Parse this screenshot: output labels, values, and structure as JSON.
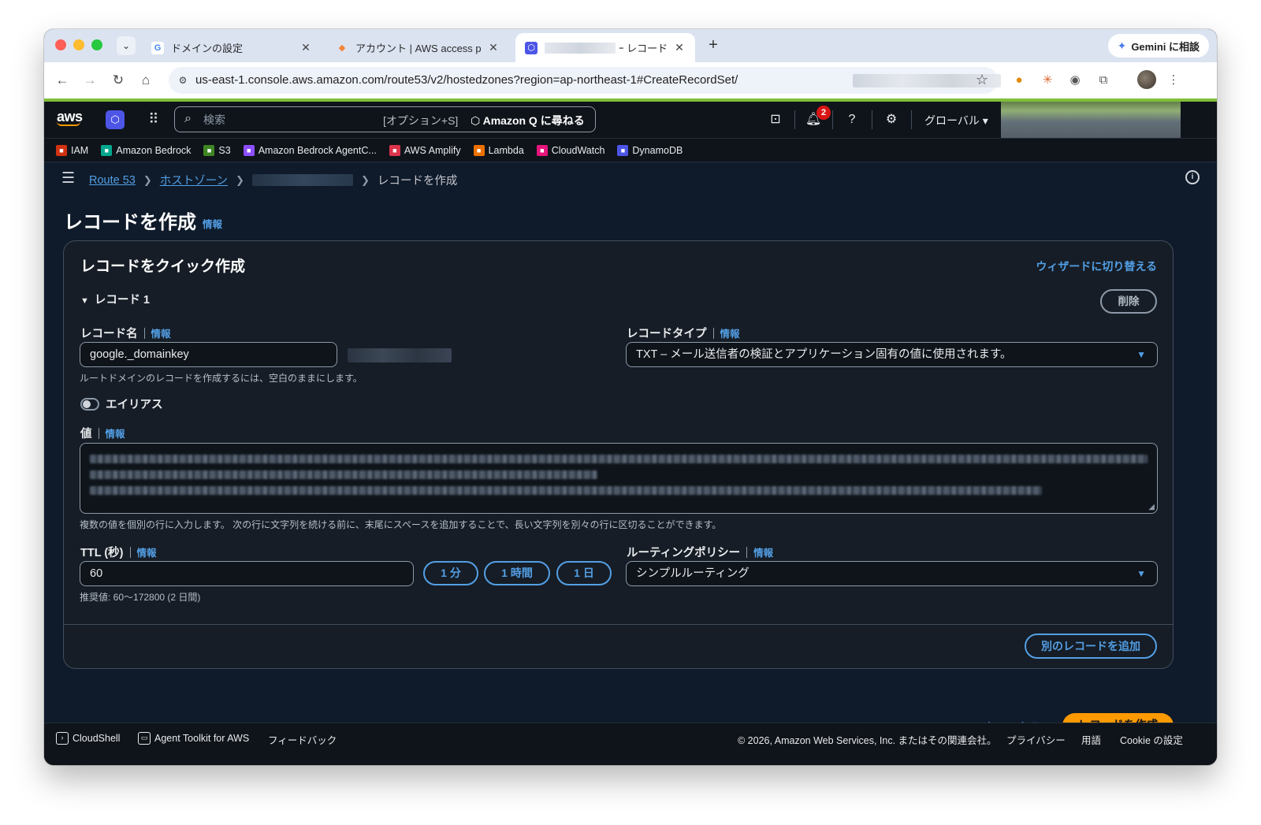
{
  "browser": {
    "tabs": [
      {
        "title": "ドメインの設定",
        "favicon": "G",
        "favicon_color": "#4285f4"
      },
      {
        "title": "アカウント | AWS access porta",
        "favicon": "◆",
        "favicon_color": "#f58536"
      },
      {
        "title": "ｰ レコード",
        "favicon": "⬡",
        "favicon_color": "#4d55e6"
      }
    ],
    "close_glyph": "✕",
    "new_tab_glyph": "+",
    "tab_menu_glyph": "⌄",
    "gemini_label": "Gemini に相談",
    "url": "us-east-1.console.aws.amazon.com/route53/v2/hostedzones?region=ap-northeast-1#CreateRecordSet/"
  },
  "aws": {
    "logo_text": "aws",
    "search_placeholder": "検索",
    "search_shortcut": "[オプション+S]",
    "ask_q": "Amazon Q に尋ねる",
    "notification_count": "2",
    "region": "グローバル ▾",
    "favorites": [
      {
        "label": "IAM",
        "color": "#d13212"
      },
      {
        "label": "Amazon Bedrock",
        "color": "#01a88d"
      },
      {
        "label": "S3",
        "color": "#3f8624"
      },
      {
        "label": "Amazon Bedrock AgentC...",
        "color": "#8c4fff"
      },
      {
        "label": "AWS Amplify",
        "color": "#dd344c"
      },
      {
        "label": "Lambda",
        "color": "#ed7100"
      },
      {
        "label": "CloudWatch",
        "color": "#e7157b"
      },
      {
        "label": "DynamoDB",
        "color": "#4d55e6"
      }
    ]
  },
  "breadcrumb": {
    "route53": "Route 53",
    "hosted_zones": "ホストゾーン",
    "current": "レコードを作成"
  },
  "page": {
    "title": "レコードを作成",
    "info": "情報"
  },
  "panel": {
    "title": "レコードをクイック作成",
    "switch_to_wizard": "ウィザードに切り替える",
    "record_header": "レコード 1",
    "delete_label": "削除",
    "record_name": {
      "label": "レコード名",
      "info": "情報",
      "value": "google._domainkey",
      "hint": "ルートドメインのレコードを作成するには、空白のままにします。"
    },
    "record_type": {
      "label": "レコードタイプ",
      "info": "情報",
      "value": "TXT – メール送信者の検証とアプリケーション固有の値に使用されます。"
    },
    "alias_label": "エイリアス",
    "value": {
      "label": "値",
      "info": "情報",
      "hint": "複数の値を個別の行に入力します。 次の行に文字列を続ける前に、末尾にスペースを追加することで、長い文字列を別々の行に区切ることができます。"
    },
    "ttl": {
      "label": "TTL (秒)",
      "info": "情報",
      "value": "60",
      "hint": "推奨値: 60～172800 (2 日間)",
      "presets": [
        "1 分",
        "1 時間",
        "1 日"
      ]
    },
    "routing_policy": {
      "label": "ルーティングポリシー",
      "info": "情報",
      "value": "シンプルルーティング"
    },
    "add_another": "別のレコードを追加"
  },
  "actions": {
    "cancel": "キャンセル",
    "create": "レコードを作成"
  },
  "footer": {
    "cloudshell": "CloudShell",
    "agent_toolkit": "Agent Toolkit for AWS",
    "feedback": "フィードバック",
    "copyright": "© 2026, Amazon Web Services, Inc. またはその関連会社。",
    "privacy": "プライバシー",
    "terms": "用語",
    "cookie": "Cookie の設定"
  },
  "colors": {
    "accent_link": "#539fe5",
    "primary_button": "#ff9900",
    "background": "#0f1b2a"
  }
}
